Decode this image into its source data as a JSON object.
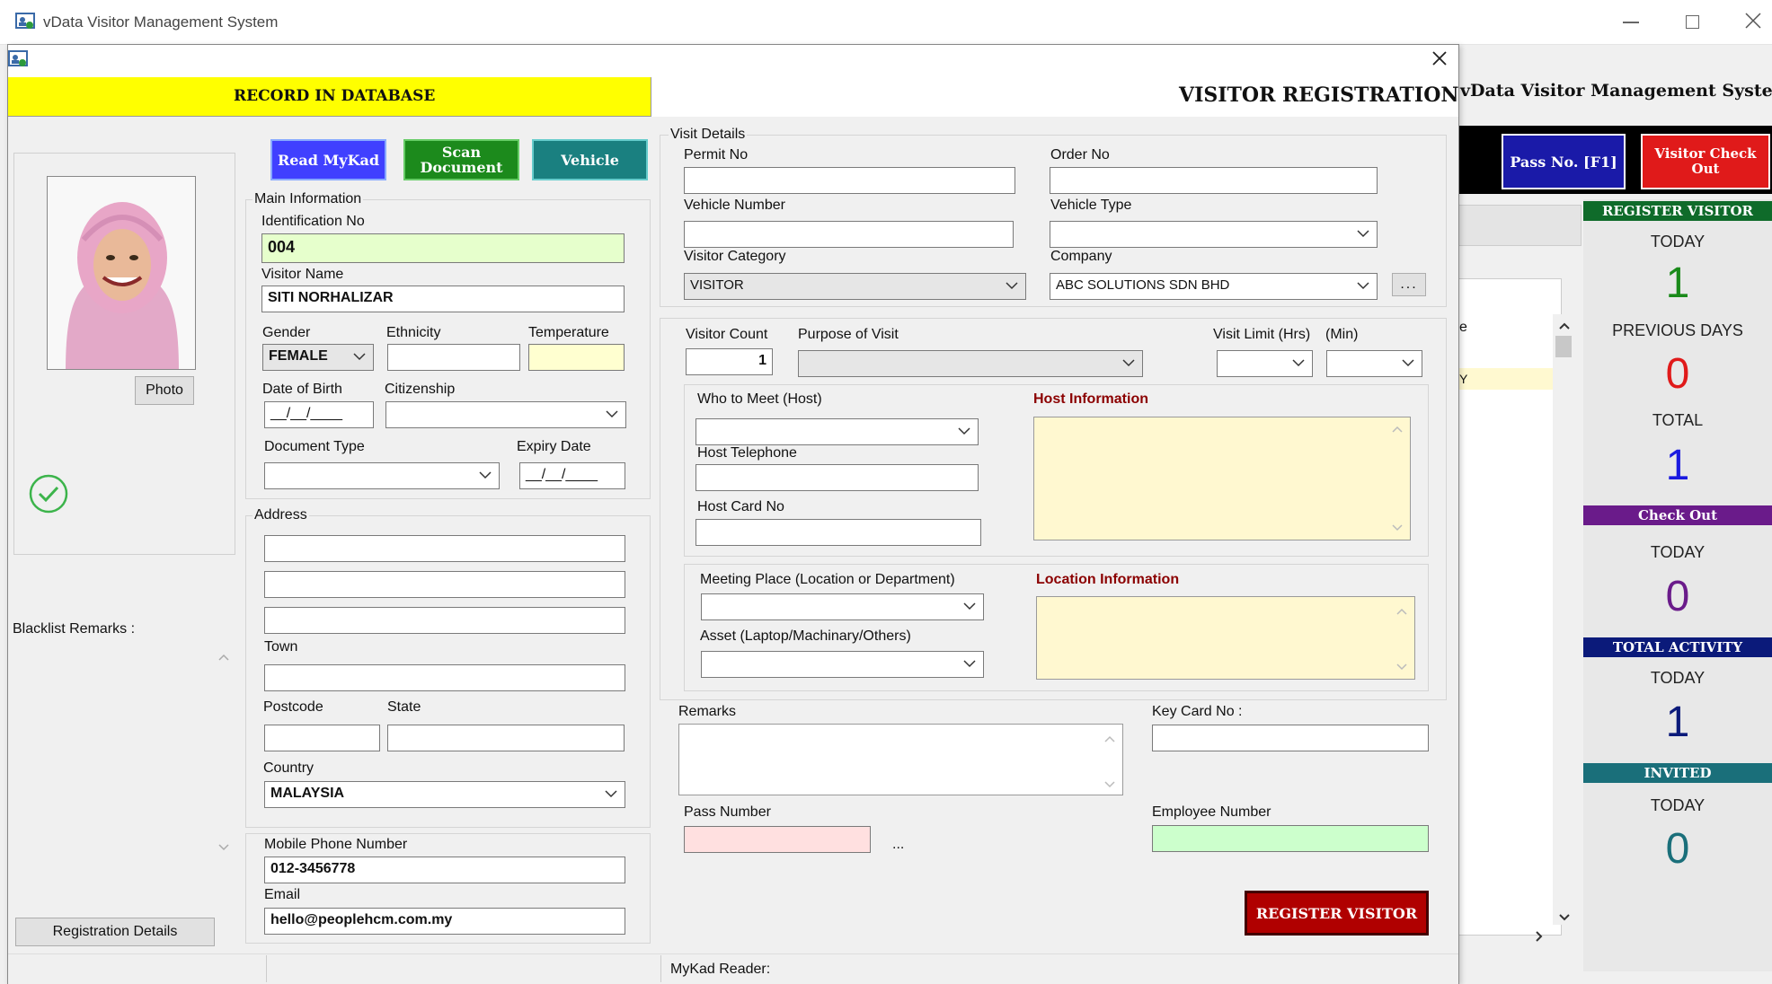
{
  "app": {
    "title": "vData Visitor Management System"
  },
  "header": {
    "record_banner": "RECORD IN DATABASE",
    "form_title": "VISITOR REGISTRATION"
  },
  "buttons": {
    "read_mykad": "Read MyKad",
    "scan_document_1": "Scan",
    "scan_document_2": "Document",
    "vehicle": "Vehicle",
    "photo": "Photo",
    "registration_details": "Registration Details",
    "register_visitor": "REGISTER VISITOR",
    "ellipsis": "...",
    "pass_ellipsis": "..."
  },
  "main_info": {
    "group": "Main Information",
    "identification_no_label": "Identification No",
    "identification_no": "004",
    "visitor_name_label": "Visitor Name",
    "visitor_name": "SITI NORHALIZAR",
    "gender_label": "Gender",
    "gender": "FEMALE",
    "ethnicity_label": "Ethnicity",
    "temperature_label": "Temperature",
    "dob_label": "Date of Birth",
    "dob_mask": "__/__/____",
    "citizenship_label": "Citizenship",
    "doc_type_label": "Document Type",
    "expiry_label": "Expiry Date",
    "expiry_mask": "__/__/____"
  },
  "address": {
    "group": "Address",
    "town_label": "Town",
    "postcode_label": "Postcode",
    "state_label": "State",
    "country_label": "Country",
    "country": "MALAYSIA"
  },
  "contact": {
    "mobile_label": "Mobile Phone Number",
    "mobile": "012-3456778",
    "email_label": "Email",
    "email": "hello@peoplehcm.com.my"
  },
  "blacklist_label": "Blacklist Remarks :",
  "visit": {
    "group": "Visit Details",
    "permit_label": "Permit No",
    "order_label": "Order No",
    "vehicle_number_label": "Vehicle Number",
    "vehicle_type_label": "Vehicle Type",
    "category_label": "Visitor Category",
    "category": "VISITOR",
    "company_label": "Company",
    "company": "ABC SOLUTIONS SDN BHD",
    "count_label": "Visitor Count",
    "count": "1",
    "purpose_label": "Purpose of Visit",
    "limit_hrs_label": "Visit Limit (Hrs)",
    "limit_min_label": "(Min)",
    "host_label": "Who to Meet (Host)",
    "host_info_label": "Host Information",
    "host_tel_label": "Host Telephone",
    "host_card_label": "Host Card No",
    "meeting_label": "Meeting Place (Location or Department)",
    "location_info_label": "Location Information",
    "asset_label": "Asset (Laptop/Machinary/Others)",
    "remarks_label": "Remarks",
    "keycard_label": "Key Card No :",
    "pass_number_label": "Pass Number",
    "employee_number_label": "Employee Number"
  },
  "status": {
    "mykad_reader": "MyKad Reader:"
  },
  "right_panel": {
    "title": "vData Visitor Management System",
    "pass_button": "Pass No. [F1]",
    "checkout_button_1": "Visitor Check",
    "checkout_button_2": "Out",
    "partial_col": "e",
    "partial_cell": "Y",
    "register_head": "REGISTER VISITOR",
    "today1": "TODAY",
    "reg_today": "1",
    "prev_days": "PREVIOUS DAYS",
    "reg_prev": "0",
    "total": "TOTAL",
    "reg_total": "1",
    "checkout_head": "Check Out",
    "today2": "TODAY",
    "checkout_today": "0",
    "activity_head": "TOTAL ACTIVITY",
    "today3": "TODAY",
    "activity_today": "1",
    "invited_head": "INVITED",
    "today4": "TODAY",
    "invited_today": "0"
  },
  "colors": {
    "banner_yellow": "#ffff00",
    "read_btn": "#4a4aff",
    "scan_btn": "#1c8a1c",
    "vehicle_btn": "#1a8080",
    "register_btn": "#b00000",
    "reg_head": "#0f6b2a",
    "checkout_head": "#6a1b8a",
    "activity_head": "#0b1a7a",
    "invited_head": "#1a6f7a"
  }
}
